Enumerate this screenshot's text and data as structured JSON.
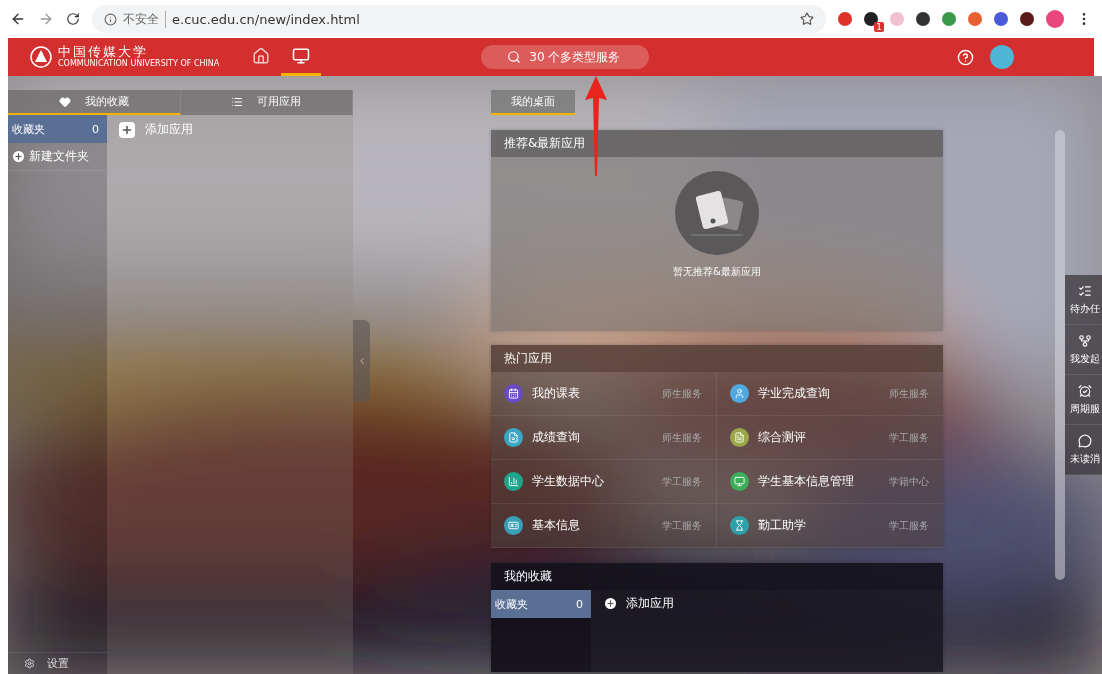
{
  "browser": {
    "security": "不安全",
    "url": "e.cuc.edu.cn/new/index.html",
    "extension_badge": "1"
  },
  "header": {
    "logo_name": "中国传媒大学",
    "logo_subtitle": "COMMUNICATION UNIVERSITY OF CHINA",
    "nav": [
      {
        "kind": "home",
        "selected": false
      },
      {
        "kind": "desktop",
        "selected": true
      }
    ],
    "search": "30 个多类型服务"
  },
  "left_panel": {
    "tabs": [
      {
        "label": "我的收藏",
        "kind": "heart",
        "selected": true
      },
      {
        "label": "可用应用",
        "kind": "list",
        "selected": false
      }
    ],
    "folders": [
      {
        "label": "收藏夹",
        "count": "0",
        "selected": true
      }
    ],
    "new_folder": "新建文件夹",
    "add_app": "添加应用",
    "settings": "设置"
  },
  "desktop_tab": {
    "label": "我的桌面",
    "selected": true
  },
  "recommended": {
    "title": "推荐&最新应用",
    "empty_text": "暂无推荐&最新应用"
  },
  "hot_apps": {
    "title": "热门应用",
    "apps": [
      {
        "name": "我的课表",
        "category": "师生服务",
        "kind": "calendar",
        "color": "#6a4bc4"
      },
      {
        "name": "学业完成查询",
        "category": "师生服务",
        "kind": "person",
        "color": "#4fa8e0"
      },
      {
        "name": "成绩查询",
        "category": "师生服务",
        "kind": "search",
        "color": "#3aa6c4"
      },
      {
        "name": "综合测评",
        "category": "学工服务",
        "kind": "document",
        "color": "#9aa84a"
      },
      {
        "name": "学生数据中心",
        "category": "学工服务",
        "kind": "chart",
        "color": "#1fa58a"
      },
      {
        "name": "学生基本信息管理",
        "category": "学籍中心",
        "kind": "monitor",
        "color": "#3cae5a"
      },
      {
        "name": "基本信息",
        "category": "学工服务",
        "kind": "idcard",
        "color": "#3aa0b8"
      },
      {
        "name": "勤工助学",
        "category": "学工服务",
        "kind": "hourglass",
        "color": "#2ea0a8"
      }
    ]
  },
  "favorites": {
    "title": "我的收藏",
    "folders": [
      {
        "label": "收藏夹",
        "count": "0",
        "selected": true
      }
    ],
    "add_app": "添加应用"
  },
  "side_menu": [
    {
      "label": "待办任",
      "kind": "tasks"
    },
    {
      "label": "我发起",
      "kind": "flow"
    },
    {
      "label": "周期服",
      "kind": "clock"
    },
    {
      "label": "未读消",
      "kind": "message"
    }
  ]
}
